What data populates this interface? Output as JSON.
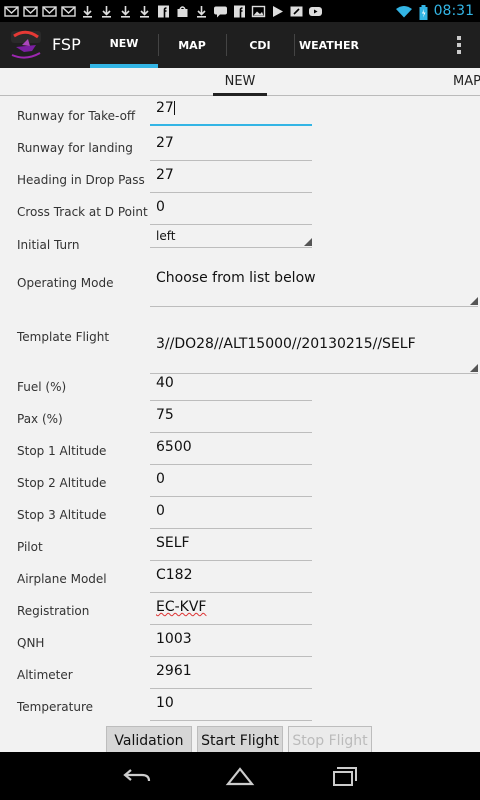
{
  "status_bar": {
    "time": "08:31",
    "icons": [
      "gmail-icon",
      "gmail-icon",
      "gmail-icon",
      "gmail-icon",
      "download-icon",
      "download-icon",
      "download-icon",
      "download-icon",
      "facebook-icon",
      "bag-icon",
      "download-icon",
      "talk-icon",
      "facebook-icon",
      "image-icon",
      "play-icon",
      "wrench-icon",
      "youtube-icon",
      "wifi-icon",
      "battery-icon"
    ]
  },
  "action_bar": {
    "title": "FSP",
    "tabs": [
      {
        "label": "NEW",
        "active": true
      },
      {
        "label": "MAP",
        "active": false
      },
      {
        "label": "CDI",
        "active": false
      },
      {
        "label": "WEATHER",
        "active": false
      }
    ]
  },
  "tab_strip": {
    "tabs": [
      {
        "label": "NEW",
        "active": true
      },
      {
        "label": "MAP",
        "active": false
      }
    ]
  },
  "form": {
    "fields": [
      {
        "label": "Runway for Take-off",
        "value": "27"
      },
      {
        "label": "Runway for landing",
        "value": "27"
      },
      {
        "label": "Heading in Drop Pass",
        "value": "27"
      },
      {
        "label": "Cross Track at D Point",
        "value": "0"
      },
      {
        "label": "Initial Turn",
        "value": "left"
      },
      {
        "label": "Operating Mode",
        "value": "Choose from list below"
      },
      {
        "label": "Template Flight",
        "value": "3//DO28//ALT15000//20130215//SELF"
      },
      {
        "label": "Fuel (%)",
        "value": "40"
      },
      {
        "label": "Pax (%)",
        "value": "75"
      },
      {
        "label": "Stop 1 Altitude",
        "value": "6500"
      },
      {
        "label": "Stop 2 Altitude",
        "value": "0"
      },
      {
        "label": "Stop 3 Altitude",
        "value": "0"
      },
      {
        "label": "Pilot",
        "value": "SELF"
      },
      {
        "label": "Airplane Model",
        "value": "C182"
      },
      {
        "label": "Registration",
        "value": "EC-KVF"
      },
      {
        "label": "QNH",
        "value": "1003"
      },
      {
        "label": "Altimeter",
        "value": "2961"
      },
      {
        "label": "Temperature",
        "value": "10"
      }
    ]
  },
  "buttons": {
    "validation": "Validation",
    "start_flight": "Start Flight",
    "stop_flight": "Stop Flight"
  },
  "colors": {
    "accent": "#33b5e5",
    "action_bar": "#1f1f1f",
    "background": "#f2f2f2"
  }
}
